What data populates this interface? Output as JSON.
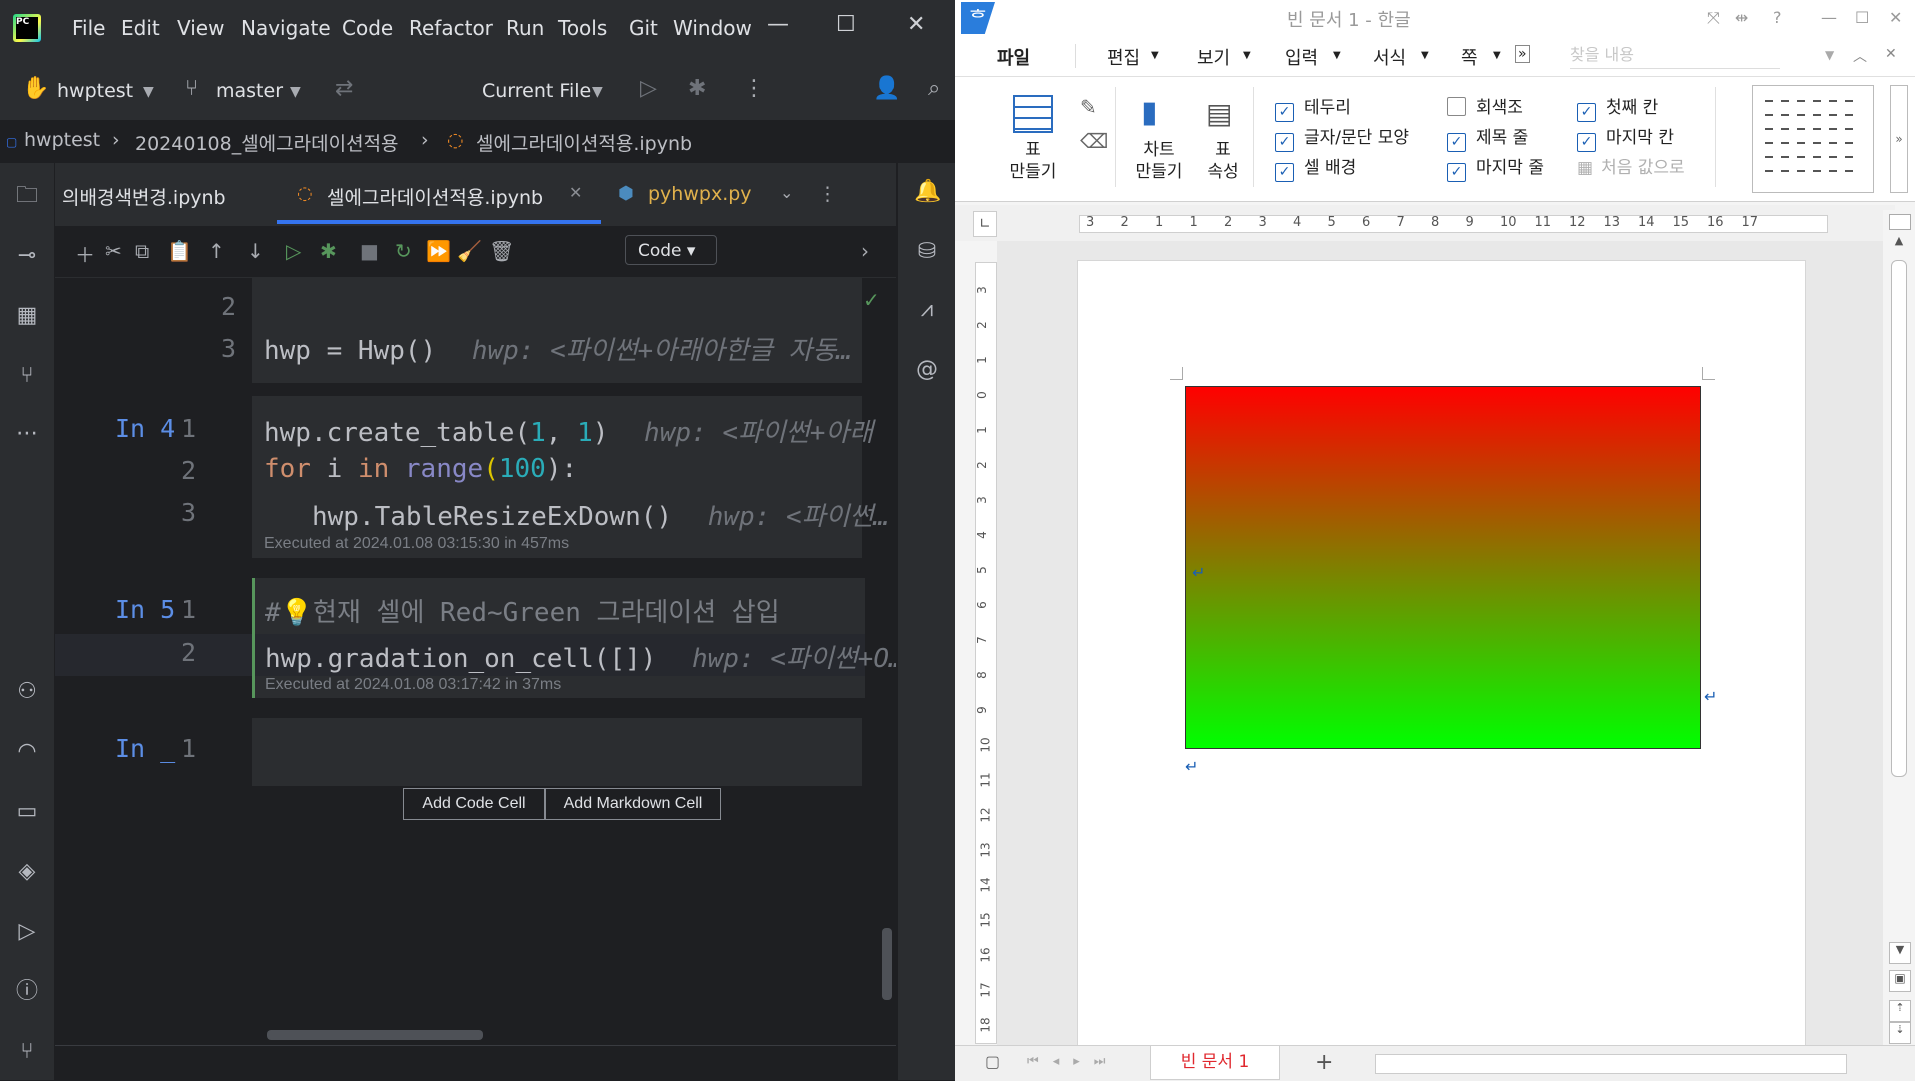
{
  "ide": {
    "menu": [
      "File",
      "Edit",
      "View",
      "Navigate",
      "Code",
      "Refactor",
      "Run",
      "Tools",
      "Git",
      "Window"
    ],
    "project": "hwptest",
    "branch": "master",
    "run_config": "Current File",
    "breadcrumb": [
      "hwptest",
      "20240108_셀에그라데이션적용",
      "셀에그라데이션적용.ipynb"
    ],
    "tabs": [
      {
        "label": "의배경색변경.ipynb"
      },
      {
        "label": "셀에그라데이션적용.ipynb",
        "active": true
      },
      {
        "label": "pyhwpx.py"
      }
    ],
    "cell_type": "Code",
    "cells": {
      "c0": {
        "g2": "2",
        "g3": "3",
        "line3": "hwp = Hwp()",
        "hint3": "hwp: <파이썬+아래아한글 자동…"
      },
      "c4": {
        "label": "In 4",
        "g1": "1",
        "g2": "2",
        "g3": "3",
        "l1a": "hwp.create_table(",
        "l1b": "1",
        "l1c": ", ",
        "l1d": "1",
        "l1e": ")",
        "hint1": "hwp: <파이썬+아래",
        "l2a": "for",
        "l2b": " i ",
        "l2c": "in",
        "l2d": " ",
        "l2e": "range",
        "l2f": "(",
        "l2g": "100",
        "l2h": "):",
        "l3": "hwp.TableResizeExDown()",
        "hint3": "hwp: <파이썬…",
        "exec": "Executed at 2024.01.08 03:15:30 in 457ms"
      },
      "c5": {
        "label": "In 5",
        "g1": "1",
        "g2": "2",
        "l1": "#💡현재 셀에 Red~Green 그라데이션 삽입",
        "l2": "hwp.gradation_on_cell([])",
        "hint2": "hwp: <파이썬+O…",
        "exec": "Executed at 2024.01.08 03:17:42 in 37ms"
      },
      "c6": {
        "label": "In _",
        "g1": "1"
      }
    },
    "add_code": "Add Code Cell",
    "add_markdown": "Add Markdown Cell"
  },
  "hwp": {
    "title": "빈 문서 1 - 한글",
    "menu": [
      "파일",
      "편집",
      "보기",
      "입력",
      "서식",
      "쪽"
    ],
    "search_placeholder": "찾을 내용",
    "ribbon": {
      "make_table": "표\n만들기",
      "make_chart": "차트\n만들기",
      "table_props": "표\n속성",
      "checks": [
        {
          "label": "테두리",
          "checked": true
        },
        {
          "label": "글자/문단 모양",
          "checked": true
        },
        {
          "label": "셀 배경",
          "checked": true
        },
        {
          "label": "회색조",
          "checked": false
        },
        {
          "label": "제목 줄",
          "checked": true
        },
        {
          "label": "마지막 줄",
          "checked": true
        },
        {
          "label": "첫째 칸",
          "checked": true
        },
        {
          "label": "마지막 칸",
          "checked": true
        },
        {
          "label": "처음 값으로",
          "checked": false
        }
      ]
    },
    "ruler_numbers": [
      "3",
      "2",
      "1",
      "1",
      "2",
      "3",
      "4",
      "5",
      "6",
      "7",
      "8",
      "9",
      "10",
      "11",
      "12",
      "13",
      "14",
      "15",
      "16",
      "17"
    ],
    "vruler_numbers": [
      "3",
      "2",
      "1",
      "0",
      "1",
      "2",
      "3",
      "4",
      "5",
      "6",
      "7",
      "8",
      "9",
      "10",
      "11",
      "12",
      "13",
      "14",
      "15",
      "16",
      "17",
      "18"
    ],
    "doc_tab": "빈 문서 1",
    "gradient": {
      "from": "#ff0000",
      "to": "#00ff00"
    }
  }
}
